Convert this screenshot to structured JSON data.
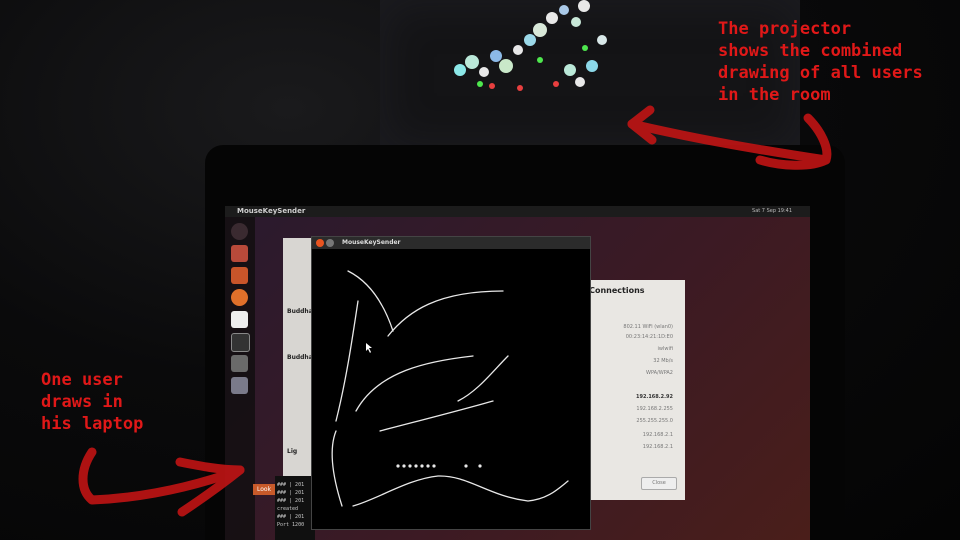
{
  "annotations": {
    "projector_note": "The projector\nshows the combined\ndrawing of all users\nin the room",
    "user_note": "One user\ndraws in\nhis laptop"
  },
  "laptop": {
    "menubar_title": "MouseKeySender",
    "menubar_status": "Sat 7 Sep 19:41",
    "drawing_window_title": "MouseKeySender",
    "connections_title": "k Connections",
    "connections_rows": [
      "802.11 WiFi (wlan0)",
      "00:23:14:21:1D:E0",
      "iwlwifi",
      "32 Mb/s",
      "WPA/WPA2",
      "192.168.2.92",
      "192.168.2.255",
      "255.255.255.0",
      "192.168.2.1",
      "192.168.2.1"
    ],
    "connections_close": "Close",
    "back_window_labels": [
      "Buddha",
      "Buddha",
      "Lig"
    ],
    "lookup_button": "Look",
    "terminal_lines": [
      "### | 201",
      "### | 201",
      "### | 201",
      "created",
      "### | 201",
      "Port 1200"
    ]
  },
  "colors": {
    "annotation_red": "#e01818",
    "ubuntu_orange": "#e95420",
    "stroke_white": "#e8e8e8"
  },
  "icons": [
    "ubuntu-logo-icon",
    "files-icon",
    "home-icon",
    "firefox-icon",
    "pidgin-icon",
    "terminal-icon",
    "wifi-icon",
    "window-icon"
  ]
}
